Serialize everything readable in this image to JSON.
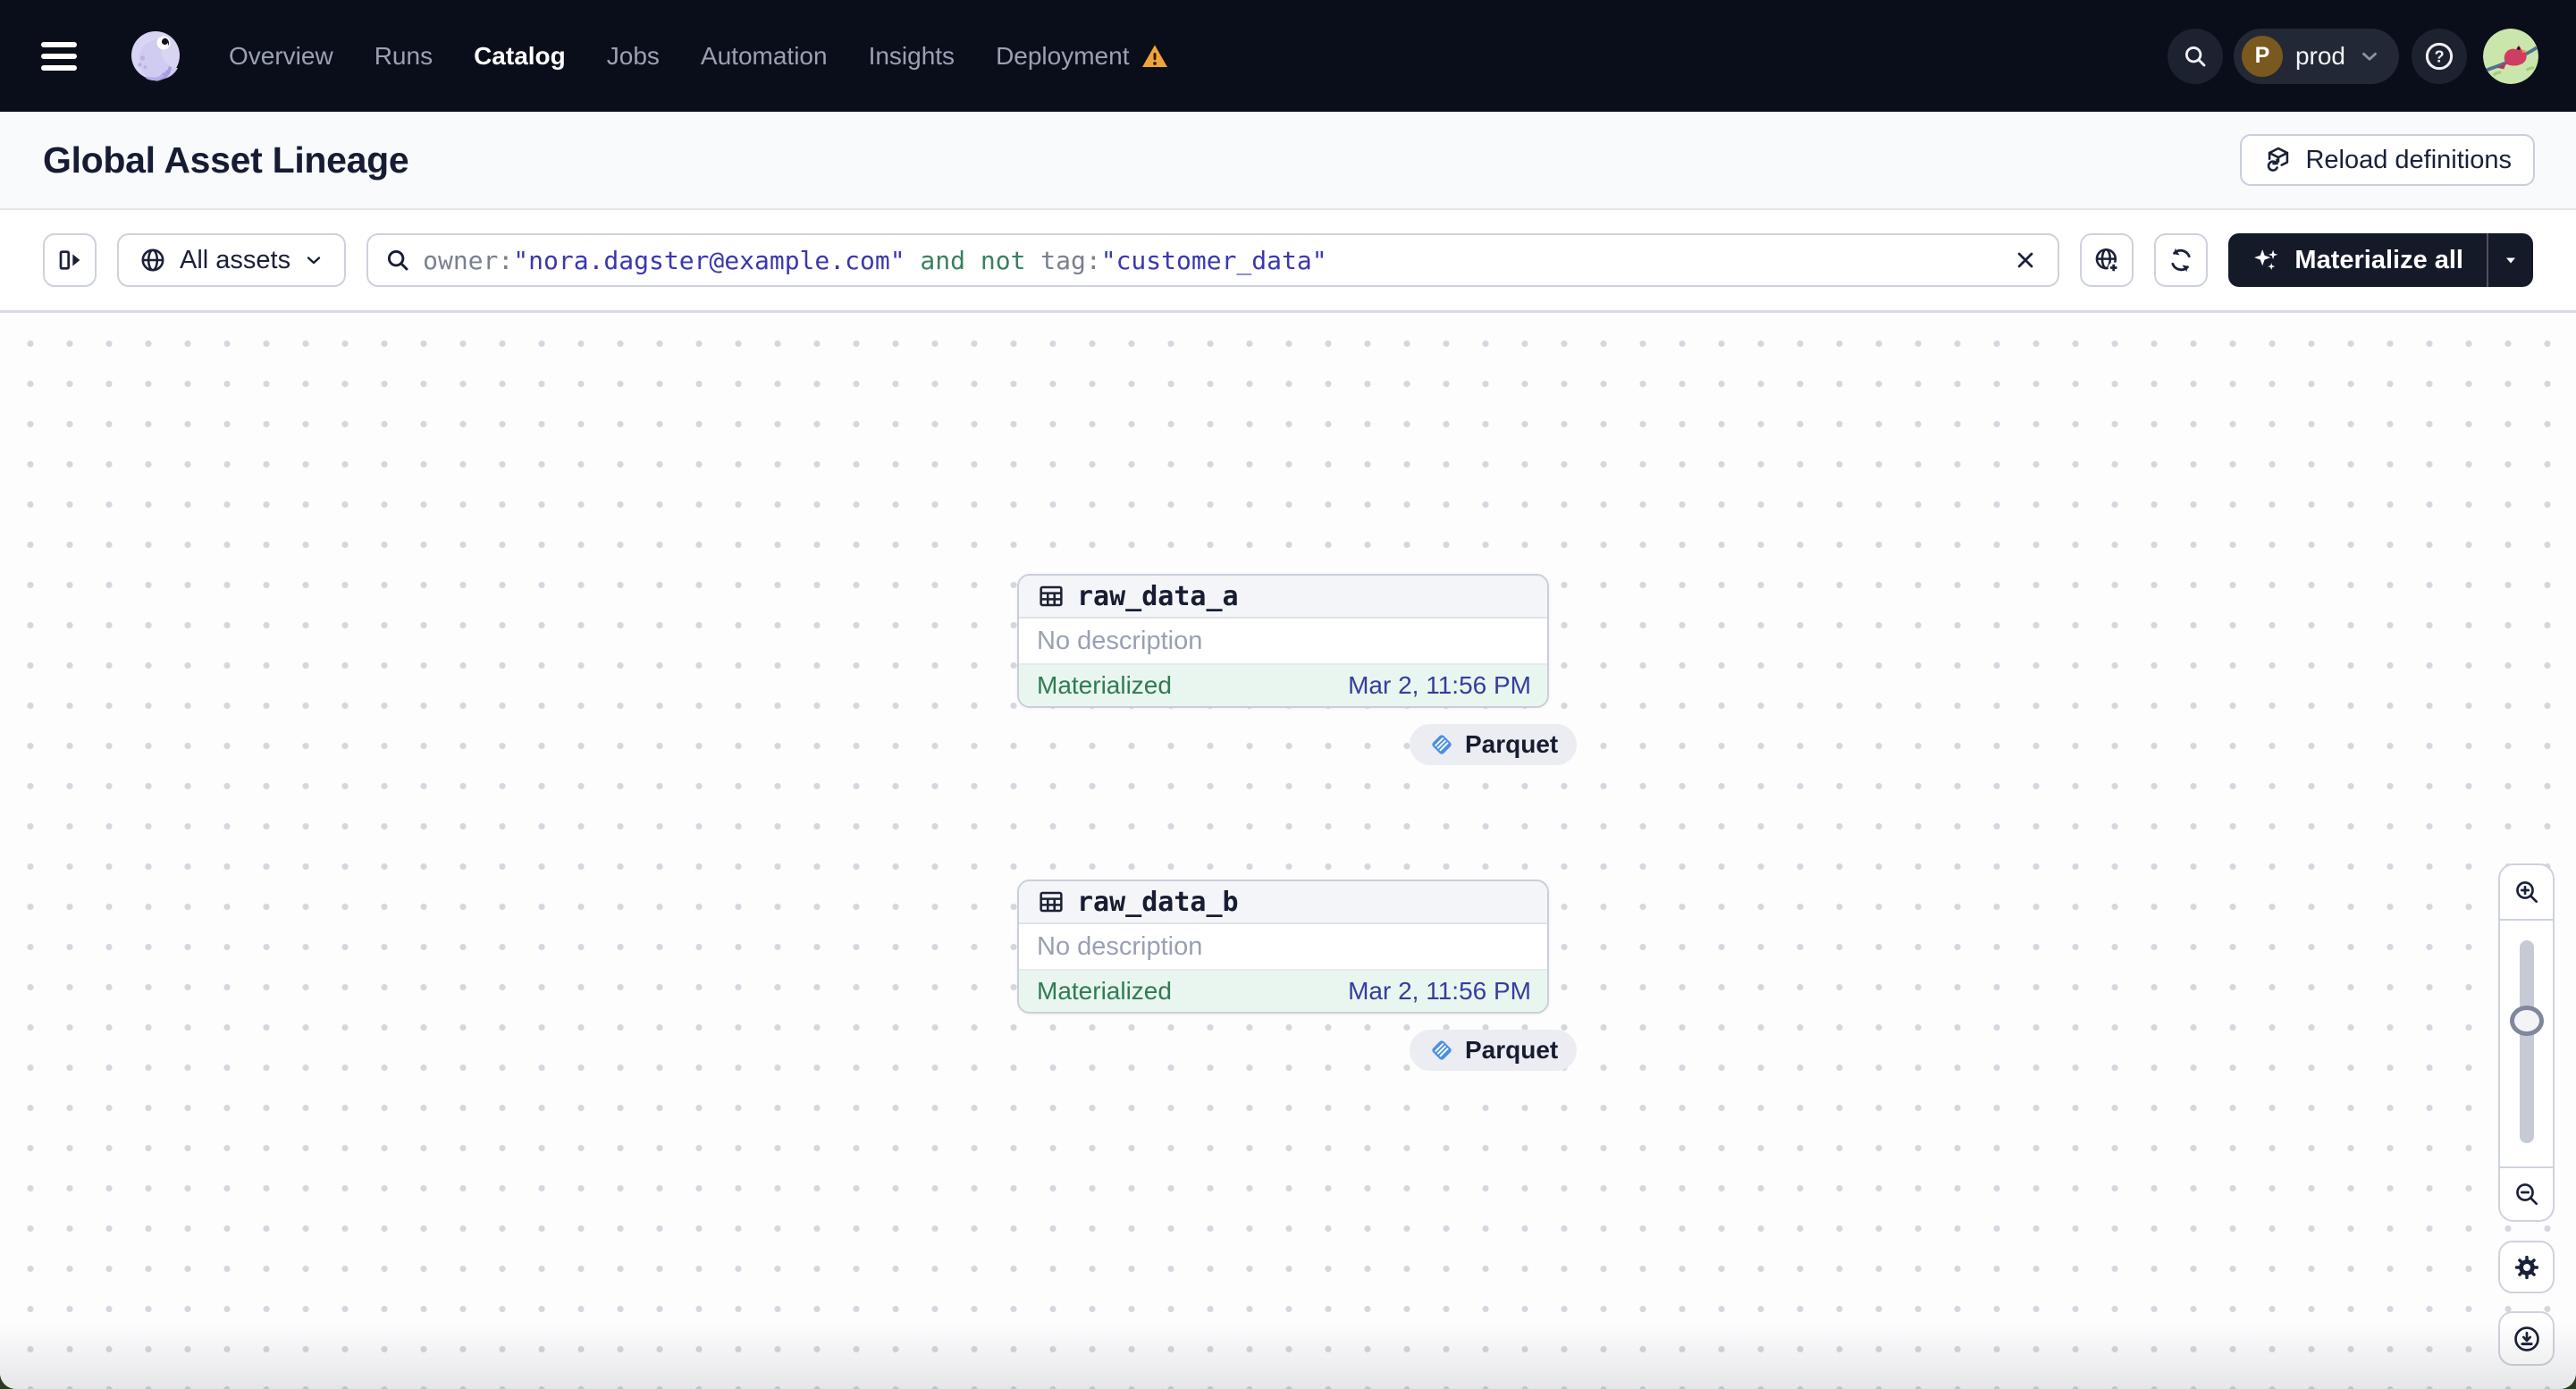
{
  "nav": {
    "items": [
      "Overview",
      "Runs",
      "Catalog",
      "Jobs",
      "Automation",
      "Insights",
      "Deployment"
    ],
    "active_item": "Catalog",
    "help_glyph": "?",
    "workspace": {
      "initial": "P",
      "name": "prod"
    }
  },
  "header": {
    "title": "Global Asset Lineage",
    "reload_label": "Reload definitions"
  },
  "toolbar": {
    "scope_label": "All assets",
    "materialize_label": "Materialize all",
    "query": {
      "t0": "owner:",
      "t1": "\"nora.dagster@example.com\"",
      "t2": " and not ",
      "t3": "tag:",
      "t4": "\"customer_data\""
    }
  },
  "graph": {
    "nodes": [
      {
        "name": "raw_data_a",
        "description": "No description",
        "status": "Materialized",
        "timestamp": "Mar 2, 11:56 PM",
        "tag": "Parquet"
      },
      {
        "name": "raw_data_b",
        "description": "No description",
        "status": "Materialized",
        "timestamp": "Mar 2, 11:56 PM",
        "tag": "Parquet"
      }
    ]
  },
  "colors": {
    "navbar_bg": "#0a0e1a",
    "materialize_bg": "#151a29",
    "query_key_gray": "#79808f",
    "query_value_indigo": "#3a37b0",
    "query_operator_green": "#38815e",
    "materialized_green": "#2e7c52",
    "materialized_row_bg": "#e9f6ef",
    "timestamp_indigo": "#363d9c",
    "warning_amber": "#efa43a",
    "parquet_blue": "#4a90e2"
  }
}
